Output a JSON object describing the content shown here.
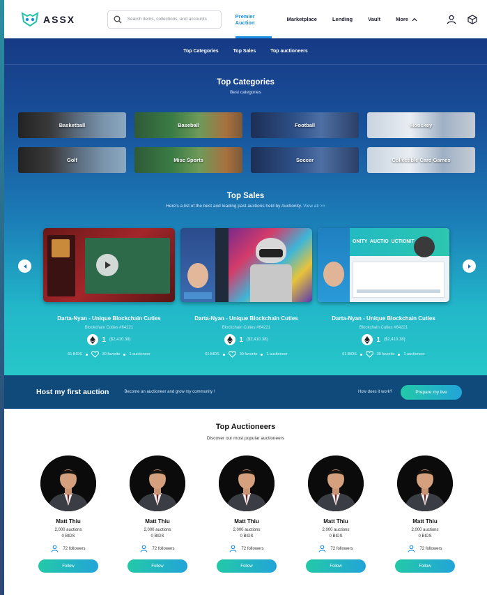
{
  "header": {
    "logo_text": "ASSX",
    "search_placeholder": "Search items, collections, and accounts",
    "nav": [
      {
        "label": "Premier Auction",
        "active": true
      },
      {
        "label": "Marketplace"
      },
      {
        "label": "Lending"
      },
      {
        "label": "Vault"
      },
      {
        "label": "More"
      }
    ],
    "icons": [
      "user-icon",
      "cube-icon"
    ]
  },
  "subnav": [
    "Top Categories",
    "Top Sales",
    "Top auctioneers"
  ],
  "top_categories": {
    "title": "Top Categories",
    "subtitle": "Best categories",
    "items": [
      "Basketball",
      "Baseball",
      "Football",
      "Hoockey",
      "Golf",
      "Misc Sports",
      "Soccer",
      "Collectible Card Games"
    ]
  },
  "top_sales": {
    "title": "Top Sales",
    "subtitle": "Here's a list of the best and leading past auctions held by Auctionity.",
    "view_all": "View all >>",
    "cards": [
      {
        "title": "Darta-Nyan - Unique Blockchain Cuties",
        "sub": "Blockchain Cuties #64221",
        "price": "1",
        "usd": "($2,410.38)",
        "bids": "61 BIDS",
        "favorite": "30 favorite",
        "auctioneer": "1 auctioneer"
      },
      {
        "title": "Darta-Nyan - Unique Blockchain Cuties",
        "sub": "Blockchain Cuties #64221",
        "price": "1",
        "usd": "($2,410.38)",
        "bids": "61 BIDS",
        "favorite": "30 favorite",
        "auctioneer": "1 auctioneer"
      },
      {
        "title": "Darta-Nyan - Unique Blockchain Cuties",
        "sub": "Blockchain Cuties #64221",
        "price": "1",
        "usd": "($2,410.38)",
        "bids": "61 BIDS",
        "favorite": "30 favorite",
        "auctioneer": "1 auctioneer"
      }
    ],
    "card3_overlay": "ONITY  AUCTIO  UCTIONIT"
  },
  "host": {
    "title": "Host my first auction",
    "subtitle": "Become an auctioneer and grow my community !",
    "how": "How does it work?",
    "button": "Prepare my live"
  },
  "top_auctioneers": {
    "title": "Top Auctioneers",
    "subtitle": "Discover our most popular auctioneers",
    "people": [
      {
        "name": "Matt Thiu",
        "auctions": "2,000 auctions",
        "bids": "0 BIDS",
        "followers": "72 followers",
        "button": "Follow"
      },
      {
        "name": "Matt Thiu",
        "auctions": "2,000 auctions",
        "bids": "0 BIDS",
        "followers": "72 followers",
        "button": "Follow"
      },
      {
        "name": "Matt Thiu",
        "auctions": "2,000 auctions",
        "bids": "0 BIDS",
        "followers": "72 followers",
        "button": "Follow"
      },
      {
        "name": "Matt Thiu",
        "auctions": "2,000 auctions",
        "bids": "0 BIDS",
        "followers": "72 followers",
        "button": "Follow"
      },
      {
        "name": "Matt Thiu",
        "auctions": "2,000 auctions",
        "bids": "0 BIDS",
        "followers": "72 followers",
        "button": "Follow"
      }
    ]
  },
  "colors": {
    "accent": "#1a8de0",
    "hero_top": "#173a85",
    "hero_bottom": "#26c7c9",
    "host_band": "#0f4a7a",
    "button_gradient_start": "#23c9a8",
    "button_gradient_end": "#22a4d8"
  }
}
